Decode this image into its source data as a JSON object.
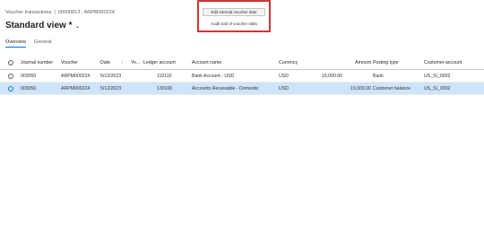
{
  "breadcrumb": {
    "page": "Voucher transactions",
    "separator": "|",
    "record": "00000813 : ARPM000224"
  },
  "view": {
    "title": "Standard view *",
    "chevron_icon": "chevron-down-icon"
  },
  "tabs": [
    {
      "label": "Overview"
    },
    {
      "label": "General"
    }
  ],
  "popup_menu": {
    "items": [
      {
        "label": "Edit internal voucher date"
      },
      {
        "label": "Audit trail of voucher edits"
      }
    ]
  },
  "grid": {
    "columns": {
      "journal_number": "Journal number",
      "voucher": "Voucher",
      "date": "Date",
      "sort_icon": "↑",
      "year": "Ye...",
      "ledger_account": "Ledger account",
      "account_name": "Account name",
      "currency": "Currency",
      "amount": "Amount",
      "posting_type": "Posting type",
      "customer_account": "Customer account"
    },
    "rows": [
      {
        "journal_number": "003050",
        "voucher": "ARPM000224",
        "date": "5/12/2023",
        "ledger_account": "110110",
        "account_name": "Bank Account - USD",
        "currency": "USD",
        "amount_debit": "19,000.00",
        "amount": "",
        "posting_type": "Bank",
        "customer_account": "US_SI_0002"
      },
      {
        "journal_number": "003050",
        "voucher": "ARPM000224",
        "date": "5/12/2023",
        "ledger_account": "130100",
        "account_name": "Accounts Receivable - Domestic",
        "currency": "USD",
        "amount_debit": "",
        "amount": "19,000.00",
        "posting_type": "Customer balance",
        "customer_account": "US_SI_0002"
      }
    ]
  },
  "colors": {
    "accent": "#0078d4",
    "selected_row": "#cfe4fa",
    "highlight_border": "#d13438"
  }
}
